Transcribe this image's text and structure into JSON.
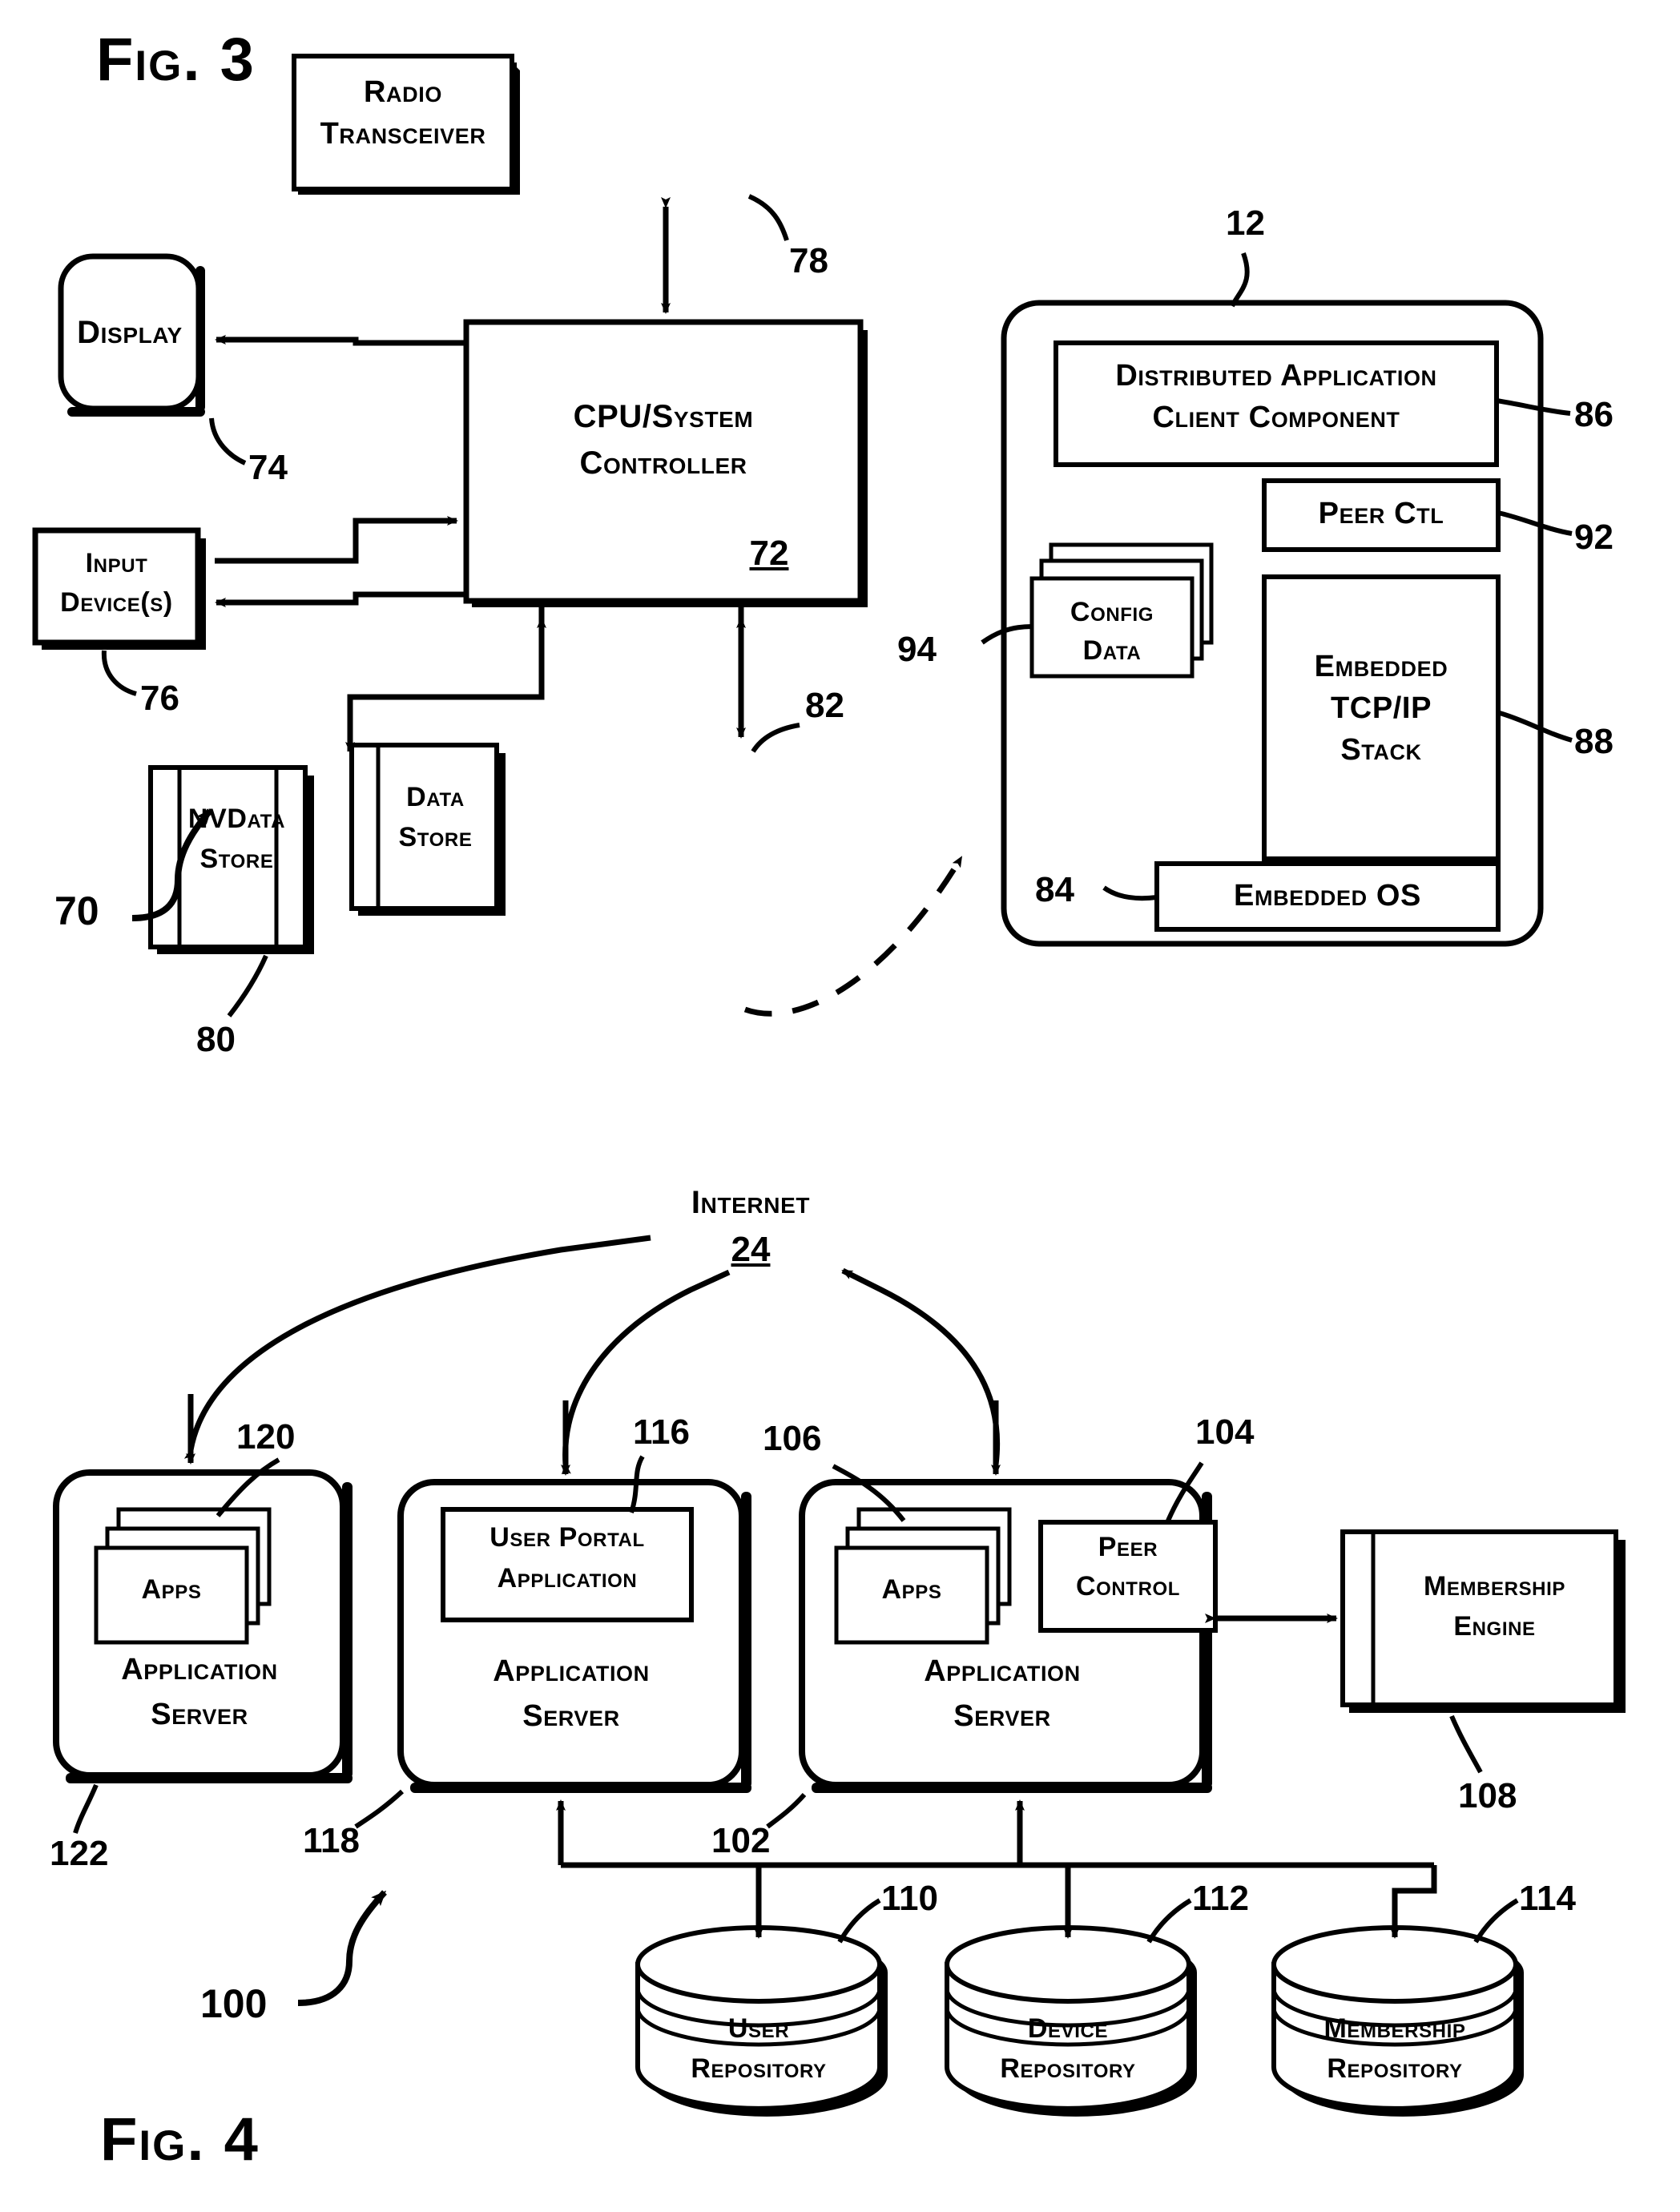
{
  "figures": [
    {
      "id": "fig3",
      "title": "Fig. 3",
      "system_ref": "70",
      "device_ref": "12",
      "blocks": [
        {
          "key": "radio_transceiver",
          "label": "Radio Transceiver",
          "ref": "78"
        },
        {
          "key": "cpu_system_controller",
          "label": "CPU/System Controller",
          "ref": "72",
          "ref_inside": true
        },
        {
          "key": "display",
          "label": "Display",
          "ref": "74"
        },
        {
          "key": "input_devices",
          "label": "Input Device(s)",
          "ref": "76"
        },
        {
          "key": "nvdata_store",
          "label": "NVData Store",
          "ref": "80"
        },
        {
          "key": "data_store",
          "label": "Data Store",
          "ref": "82"
        },
        {
          "key": "distributed_application_client_component",
          "label": "Distributed Application Client Component",
          "ref": "86"
        },
        {
          "key": "peer_ctl",
          "label": "Peer Ctl",
          "ref": "92"
        },
        {
          "key": "config_data",
          "label": "Config Data",
          "ref": "94"
        },
        {
          "key": "embedded_tcpip_stack",
          "label": "Embedded TCP/IP Stack",
          "ref": "88"
        },
        {
          "key": "embedded_os",
          "label": "Embedded OS",
          "ref": "84"
        }
      ]
    },
    {
      "id": "fig4",
      "title": "Fig. 4",
      "system_ref": "100",
      "network": {
        "label": "Internet",
        "ref": "24"
      },
      "blocks": [
        {
          "key": "apps_left",
          "label": "Apps",
          "ref": "120"
        },
        {
          "key": "application_server_left",
          "label": "Application Server",
          "ref": "122"
        },
        {
          "key": "user_portal_application",
          "label": "User Portal Application",
          "ref": "116"
        },
        {
          "key": "application_server_mid",
          "label": "Application Server",
          "ref": "118"
        },
        {
          "key": "apps_right",
          "label": "Apps",
          "ref": "106"
        },
        {
          "key": "peer_control",
          "label": "Peer Control",
          "ref": "104"
        },
        {
          "key": "application_server_right",
          "label": "Application Server",
          "ref": "102"
        },
        {
          "key": "membership_engine",
          "label": "Membership Engine",
          "ref": "108"
        },
        {
          "key": "user_repository",
          "label": "User Repository",
          "ref": "110"
        },
        {
          "key": "device_repository",
          "label": "Device Repository",
          "ref": "112"
        },
        {
          "key": "membership_repository",
          "label": "Membership Repository",
          "ref": "114"
        }
      ]
    }
  ],
  "text": {
    "fig3_title": "Fig. 3",
    "fig4_title": "Fig. 4",
    "radio_transceiver_l1": "Radio",
    "radio_transceiver_l2": "Transceiver",
    "cpu_l1": "CPU/System",
    "cpu_l2": "Controller",
    "cpu_ref": "72",
    "display": "Display",
    "input_l1": "Input",
    "input_l2": "Device(s)",
    "nvdata_l1": "NVData",
    "nvdata_l2": "Store",
    "datastore_l1": "Data",
    "datastore_l2": "Store",
    "dacc_l1": "Distributed Application",
    "dacc_l2": "Client Component",
    "peer_ctl": "Peer Ctl",
    "config_l1": "Config",
    "config_l2": "Data",
    "tcpip_l1": "Embedded",
    "tcpip_l2": "TCP/IP",
    "tcpip_l3": "Stack",
    "embedded_os": "Embedded OS",
    "internet": "Internet",
    "internet_ref": "24",
    "apps": "Apps",
    "app_server_l1": "Application",
    "app_server_l2": "Server",
    "user_portal_l1": "User Portal",
    "user_portal_l2": "Application",
    "peer_control_l1": "Peer",
    "peer_control_l2": "Control",
    "membership_engine_l1": "Membership",
    "membership_engine_l2": "Engine",
    "user_repo_l1": "User",
    "user_repo_l2": "Repository",
    "device_repo_l1": "Device",
    "device_repo_l2": "Repository",
    "membership_repo_l1": "Membership",
    "membership_repo_l2": "Repository"
  },
  "refs": {
    "r12": "12",
    "r24": "24",
    "r70": "70",
    "r72": "72",
    "r74": "74",
    "r76": "76",
    "r78": "78",
    "r80": "80",
    "r82": "82",
    "r84": "84",
    "r86": "86",
    "r88": "88",
    "r92": "92",
    "r94": "94",
    "r100": "100",
    "r102": "102",
    "r104": "104",
    "r106": "106",
    "r108": "108",
    "r110": "110",
    "r112": "112",
    "r114": "114",
    "r116": "116",
    "r118": "118",
    "r120": "120",
    "r122": "122"
  },
  "colors": {
    "ink": "#000000",
    "paper": "#ffffff"
  }
}
